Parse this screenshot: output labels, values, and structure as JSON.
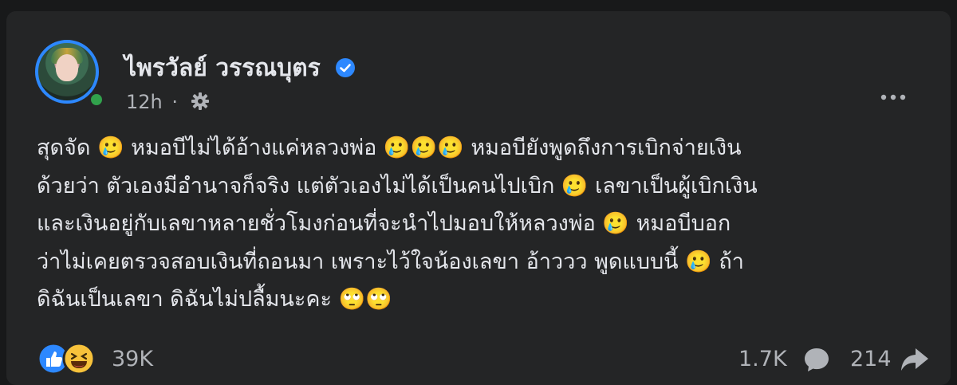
{
  "post": {
    "author": "ไพรวัลย์ วรรณบุตร",
    "time": "12h",
    "separator": "·",
    "lines": [
      "สุดจัด 🥲 หมอบีไม่ได้อ้างแค่หลวงพ่อ 🥲🥲🥲 หมอบียังพูดถึงการเบิกจ่ายเงิน",
      "ด้วยว่า ตัวเองมีอำนาจก็จริง แต่ตัวเองไม่ได้เป็นคนไปเบิก 🥲 เลขาเป็นผู้เบิกเงิน",
      "และเงินอยู่กับเลขาหลายชั่วโมงก่อนที่จะนำไปมอบให้หลวงพ่อ 🥲 หมอบีบอก",
      "ว่าไม่เคยตรวจสอบเงินที่ถอนมา เพราะไว้ใจน้องเลขา อ้าววว พูดแบบนี้ 🥲 ถ้า",
      "ดิฉันเป็นเลขา ดิฉันไม่ปลื้มนะคะ 🙄🙄"
    ]
  },
  "footer": {
    "reactions_count": "39K",
    "comments_count": "1.7K",
    "shares_count": "214"
  },
  "icons": {
    "verified": "verified-badge-icon",
    "privacy": "gear-icon",
    "more": "more-dots-icon",
    "like": "like-icon",
    "haha": "haha-icon",
    "comment": "comment-icon",
    "share": "share-icon"
  },
  "colors": {
    "background": "#18191a",
    "card": "#242526",
    "text": "#e4e6eb",
    "muted": "#b0b3b8",
    "accent": "#2d88ff",
    "online": "#31a24c"
  }
}
